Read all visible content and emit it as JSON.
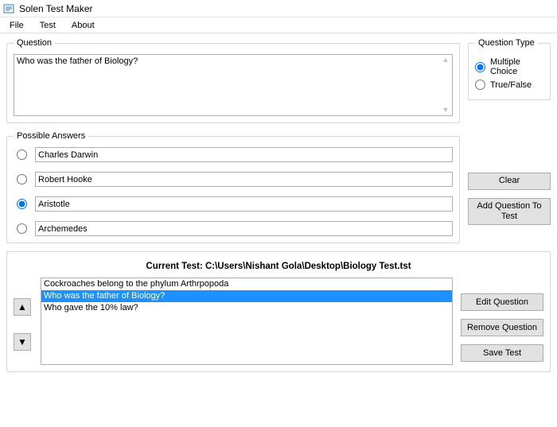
{
  "app": {
    "title": "Solen Test Maker"
  },
  "menu": {
    "file": "File",
    "test": "Test",
    "about": "About"
  },
  "question": {
    "group_label": "Question",
    "text": "Who was the father of Biology?"
  },
  "question_type": {
    "group_label": "Question Type",
    "multiple_choice": "Multiple Choice",
    "true_false": "True/False",
    "selected": "multiple_choice"
  },
  "answers": {
    "group_label": "Possible Answers",
    "items": [
      {
        "text": "Charles Darwin",
        "correct": false
      },
      {
        "text": "Robert Hooke",
        "correct": false
      },
      {
        "text": "Aristotle",
        "correct": true
      },
      {
        "text": "Archemedes",
        "correct": false
      }
    ]
  },
  "side_buttons": {
    "clear": "Clear",
    "add_question": "Add Question To Test"
  },
  "current_test": {
    "label_prefix": "Current Test: ",
    "path": "C:\\Users\\Nishant Gola\\Desktop\\Biology Test.tst",
    "questions": [
      {
        "text": "Cockroaches belong to the phylum Arthrpopoda",
        "selected": false
      },
      {
        "text": "Who was the father of Biology?",
        "selected": true
      },
      {
        "text": "Who gave the 10% law?",
        "selected": false
      }
    ]
  },
  "bottom_buttons": {
    "edit": "Edit Question",
    "remove": "Remove Question",
    "save": "Save Test"
  }
}
